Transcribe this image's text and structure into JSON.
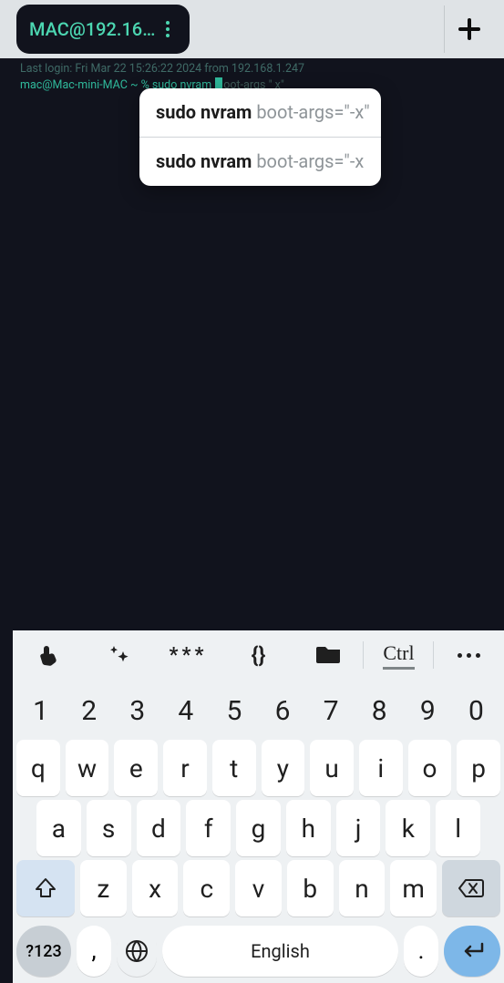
{
  "tab": {
    "title": "MAC@192.168…"
  },
  "terminal": {
    "last_login": "Last login: Fri Mar 22 15:26:22 2024 from 192.168.1.247",
    "prompt": "mac@Mac-mini-MAC ~ % ",
    "typed": "sudo nvram ",
    "ghost": "oot-args \" x\""
  },
  "suggestions": [
    {
      "bold": "sudo nvram",
      "rest": " boot-args=\"-x\""
    },
    {
      "bold": "sudo nvram",
      "rest": " boot-args=\"-x"
    }
  ],
  "toolbar": {
    "asterisks": "***",
    "braces": "{}",
    "ctrl": "Ctrl"
  },
  "keyboard": {
    "numbers": [
      "1",
      "2",
      "3",
      "4",
      "5",
      "6",
      "7",
      "8",
      "9",
      "0"
    ],
    "row1": [
      "q",
      "w",
      "e",
      "r",
      "t",
      "y",
      "u",
      "i",
      "o",
      "p"
    ],
    "row2": [
      "a",
      "s",
      "d",
      "f",
      "g",
      "h",
      "j",
      "k",
      "l"
    ],
    "row3": [
      "z",
      "x",
      "c",
      "v",
      "b",
      "n",
      "m"
    ],
    "sym": "?123",
    "comma": ",",
    "period": ".",
    "space": "English"
  }
}
